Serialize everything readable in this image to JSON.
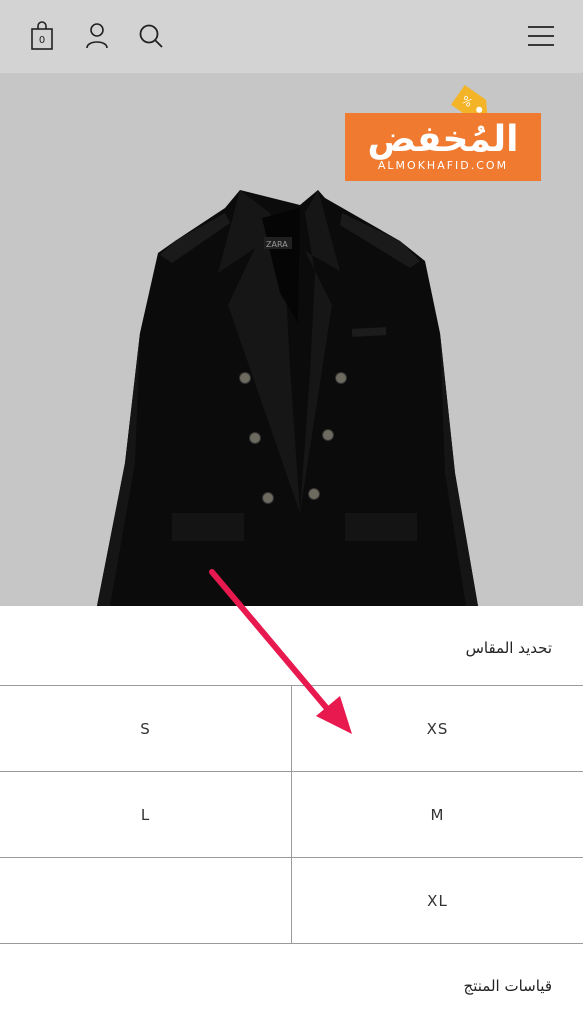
{
  "header": {
    "cart_count": "0",
    "icons": [
      "cart-icon",
      "user-icon",
      "search-icon",
      "menu-icon"
    ]
  },
  "watermark": {
    "arabic": "المُخفض",
    "latin": "ALMOKHAFID.COM",
    "color": "#ef7a30"
  },
  "product": {
    "brand_label": "ZARA"
  },
  "size_panel": {
    "title": "تحديد المقاس",
    "sizes": [
      {
        "left": "S",
        "right": "XS"
      },
      {
        "left": "L",
        "right": "M"
      },
      {
        "left": "",
        "right": "XL"
      }
    ],
    "guide_label": "قياسات المنتج"
  },
  "annotation": {
    "arrow_color": "#e8194f"
  }
}
